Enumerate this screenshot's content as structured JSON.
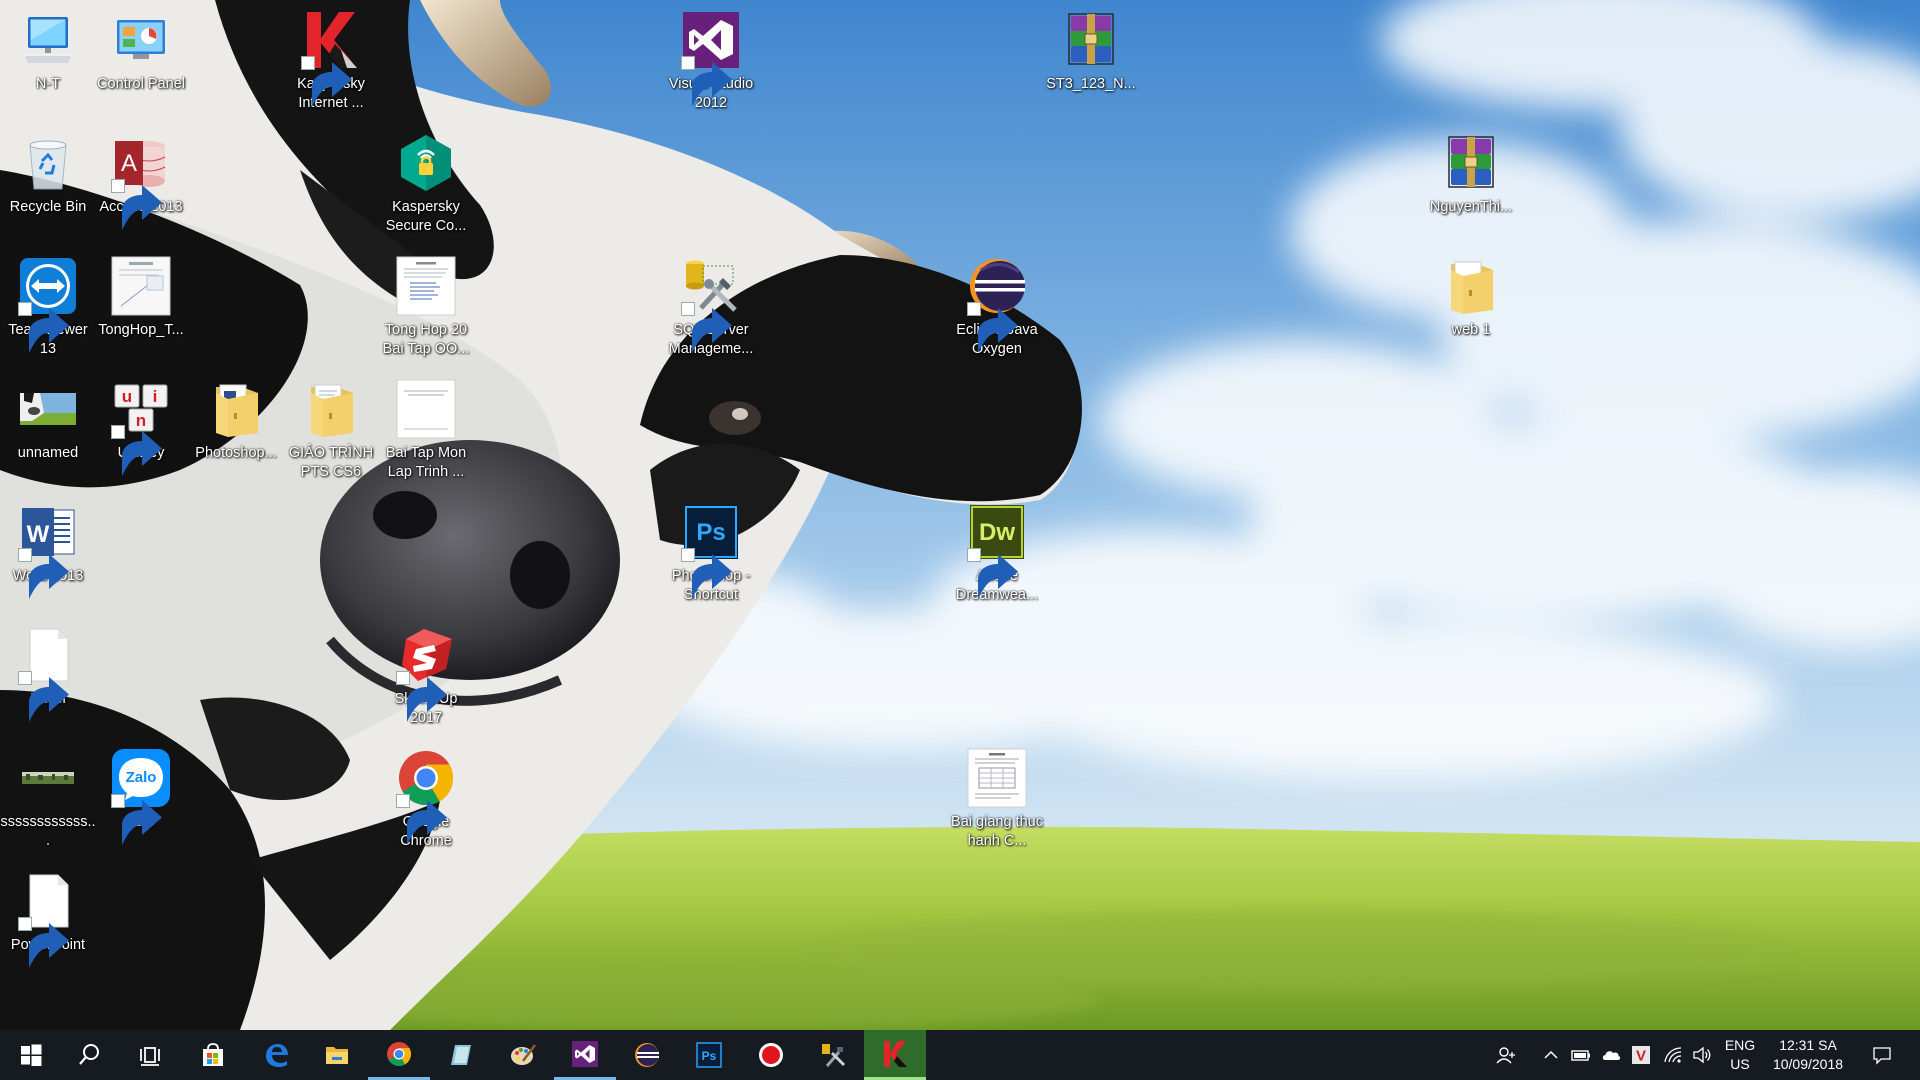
{
  "desktop": {
    "icons": [
      {
        "label": "N-T",
        "icon": "pc-icon",
        "shortcut": false
      },
      {
        "label": "Control Panel",
        "icon": "control-panel-icon",
        "shortcut": false
      },
      {
        "label": "Kaspersky Internet ...",
        "icon": "kaspersky-icon",
        "shortcut": true
      },
      {
        "label": "Visual Studio 2012",
        "icon": "visual-studio-icon",
        "shortcut": true
      },
      {
        "label": "ST3_123_N...",
        "icon": "winrar-archive-icon",
        "shortcut": false
      },
      {
        "label": "Recycle Bin",
        "icon": "recycle-bin-icon",
        "shortcut": false
      },
      {
        "label": "Access 2013",
        "icon": "access-icon",
        "shortcut": true
      },
      {
        "label": "Kaspersky Secure Co...",
        "icon": "kaspersky-secure-connection-icon",
        "shortcut": false
      },
      {
        "label": "NguyenThi...",
        "icon": "winrar-archive-icon",
        "shortcut": false
      },
      {
        "label": "TeamViewer 13",
        "icon": "teamviewer-icon",
        "shortcut": true
      },
      {
        "label": "TongHop_T...",
        "icon": "document-thumbnail-icon",
        "shortcut": false
      },
      {
        "label": "Tong Hop 20 Bai Tap OO...",
        "icon": "document-thumbnail-icon",
        "shortcut": false
      },
      {
        "label": "SQL Server Manageme...",
        "icon": "sql-server-icon",
        "shortcut": true
      },
      {
        "label": "Eclipse Java Oxygen",
        "icon": "eclipse-icon",
        "shortcut": true
      },
      {
        "label": "web 1",
        "icon": "folder-icon",
        "shortcut": false
      },
      {
        "label": "unnamed",
        "icon": "image-thumbnail-icon",
        "shortcut": false
      },
      {
        "label": "UniKey",
        "icon": "unikey-icon",
        "shortcut": true
      },
      {
        "label": "Photoshop...",
        "icon": "folder-icon",
        "shortcut": false
      },
      {
        "label": "GIÁO TRÌNH PTS CS6",
        "icon": "folder-icon",
        "shortcut": false
      },
      {
        "label": "Bai Tap Mon Lap Trinh ...",
        "icon": "document-thumbnail-icon",
        "shortcut": false
      },
      {
        "label": "Word 2013",
        "icon": "word-icon",
        "shortcut": true
      },
      {
        "label": "Photoshop - Shortcut",
        "icon": "photoshop-icon",
        "shortcut": true
      },
      {
        "label": "Adobe Dreamwea...",
        "icon": "dreamweaver-icon",
        "shortcut": true
      },
      {
        "label": "Excel",
        "icon": "blank-file-icon",
        "shortcut": true
      },
      {
        "label": "SketchUp 2017",
        "icon": "sketchup-icon",
        "shortcut": true
      },
      {
        "label": "ssssssssssss...",
        "icon": "image-thumbnail-icon",
        "shortcut": false
      },
      {
        "label": "Zalo",
        "icon": "zalo-icon",
        "shortcut": true
      },
      {
        "label": "Google Chrome",
        "icon": "chrome-icon",
        "shortcut": true
      },
      {
        "label": "Bai giang thuc hanh C...",
        "icon": "document-thumbnail-icon",
        "shortcut": false
      },
      {
        "label": "PowerPoint",
        "icon": "blank-file-icon",
        "shortcut": true
      }
    ],
    "logo_text": {
      "photoshop": "Ps",
      "dreamweaver": "Dw",
      "zalo": "Zalo",
      "word": "W",
      "access": "A",
      "unikey": [
        "u",
        "i",
        "n"
      ]
    }
  },
  "taskbar": {
    "apps": [
      {
        "icon": "windows-start-icon",
        "state": "normal"
      },
      {
        "icon": "search-icon",
        "state": "normal"
      },
      {
        "icon": "task-view-icon",
        "state": "normal"
      },
      {
        "icon": "store-icon",
        "state": "normal"
      },
      {
        "icon": "edge-icon",
        "state": "normal"
      },
      {
        "icon": "file-explorer-icon",
        "state": "normal"
      },
      {
        "icon": "chrome-icon",
        "state": "running"
      },
      {
        "icon": "app-icon",
        "state": "normal"
      },
      {
        "icon": "paint-icon",
        "state": "normal"
      },
      {
        "icon": "visual-studio-icon",
        "state": "running"
      },
      {
        "icon": "eclipse-icon",
        "state": "normal"
      },
      {
        "icon": "photoshop-icon",
        "state": "normal"
      },
      {
        "icon": "record-icon",
        "state": "normal"
      },
      {
        "icon": "sql-server-icon",
        "state": "normal"
      },
      {
        "icon": "kaspersky-icon",
        "state": "active"
      }
    ],
    "tray": {
      "icons": [
        "people-icon",
        "chevron-up-icon",
        "battery-icon",
        "onedrive-cloud-icon",
        "vietkey-icon",
        "wifi-icon",
        "volume-icon"
      ],
      "vietkey_text": "V",
      "language": "ENG",
      "region": "US",
      "time": "12:31 SA",
      "date": "10/09/2018",
      "notification_icon": "action-center-icon"
    }
  },
  "colors": {
    "taskbar_bg": "#121418",
    "active_app_bg": "#2f6b2a",
    "running_indicator": "#76b9ed",
    "label_text": "#ffffff"
  }
}
